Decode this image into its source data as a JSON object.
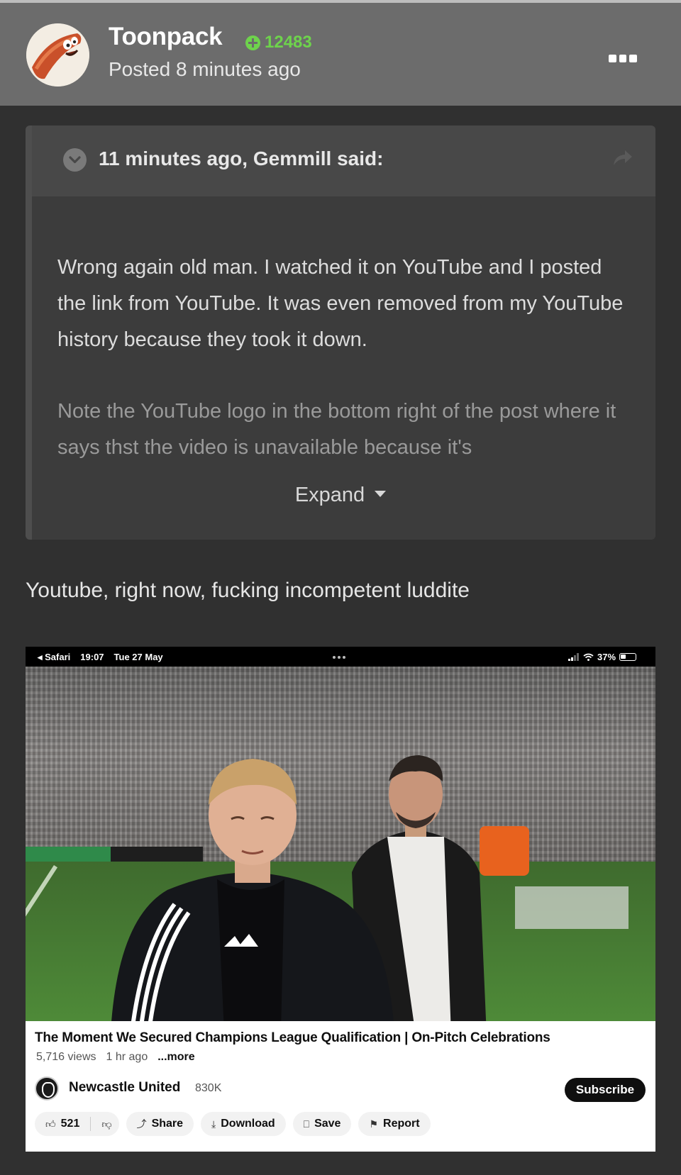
{
  "post": {
    "author": "Toonpack",
    "reputation": "12483",
    "posted": "Posted 8 minutes ago"
  },
  "quote": {
    "citation": "11 minutes ago, Gemmill said:",
    "paragraph1": "Wrong again old man. I watched it on YouTube and I posted the link from YouTube. It was even removed from my YouTube history because they took it down.",
    "paragraph2": "Note the YouTube logo in the bottom right of the post where it says thst the video is unavailable because it's",
    "expand_label": "Expand"
  },
  "post_text": "Youtube, right now, fucking incompetent luddite",
  "screenshot": {
    "status": {
      "app": "Safari",
      "time": "19:07",
      "date": "Tue 27 May",
      "battery": "37%"
    },
    "video_title": "The Moment We Secured Champions League Qualification | On-Pitch Celebrations",
    "views": "5,716 views",
    "age": "1 hr ago",
    "more": "...more",
    "channel": "Newcastle United",
    "subscribers": "830K",
    "subscribe_label": "Subscribe",
    "likes": "521",
    "share_label": "Share",
    "download_label": "Download",
    "save_label": "Save",
    "report_label": "Report"
  },
  "colors": {
    "header_bg": "#6c6c6c",
    "page_bg": "#303030",
    "reputation": "#6ed34c"
  }
}
